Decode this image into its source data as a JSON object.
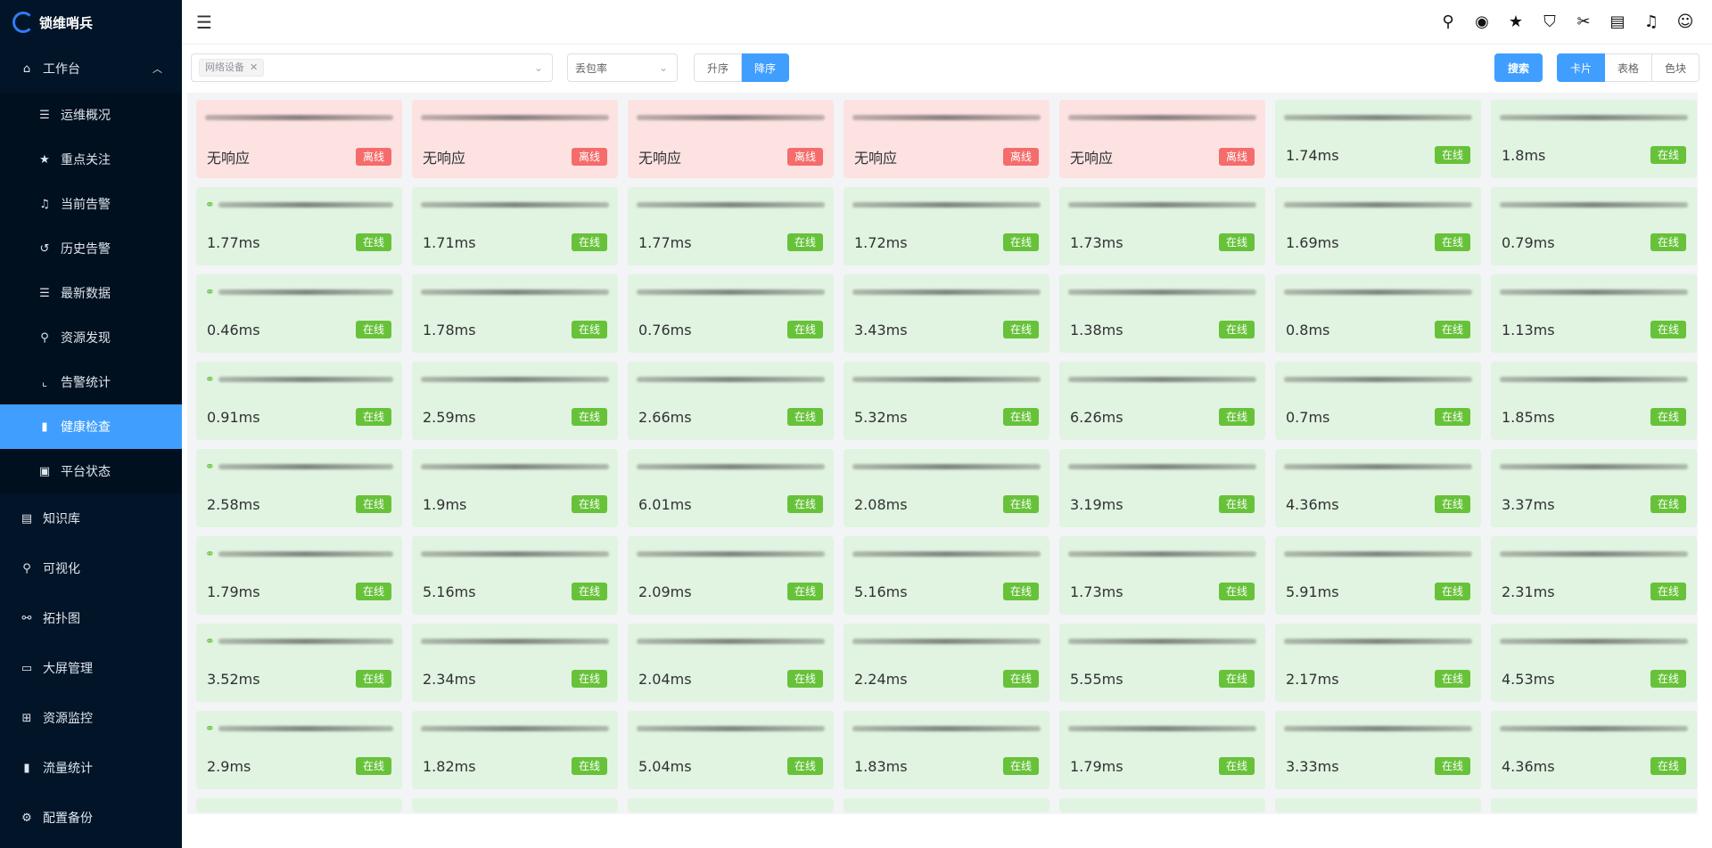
{
  "brand": {
    "name": "锁维哨兵"
  },
  "sidebar": {
    "workbench": {
      "label": "工作台",
      "icon": "home-icon"
    },
    "submenu": [
      {
        "label": "运维概况",
        "icon": "list-icon"
      },
      {
        "label": "重点关注",
        "icon": "star-icon"
      },
      {
        "label": "当前告警",
        "icon": "bell-icon"
      },
      {
        "label": "历史告警",
        "icon": "history-icon"
      },
      {
        "label": "最新数据",
        "icon": "database-icon"
      },
      {
        "label": "资源发现",
        "icon": "search-zoom-icon"
      },
      {
        "label": "告警统计",
        "icon": "line-chart-icon"
      },
      {
        "label": "健康检查",
        "icon": "bar-chart-icon",
        "active": true
      },
      {
        "label": "平台状态",
        "icon": "status-icon"
      }
    ],
    "items": [
      {
        "label": "知识库",
        "icon": "book-icon"
      },
      {
        "label": "可视化",
        "icon": "magnifier-icon"
      },
      {
        "label": "拓扑图",
        "icon": "topology-icon"
      },
      {
        "label": "大屏管理",
        "icon": "monitor-icon"
      },
      {
        "label": "资源监控",
        "icon": "grid-icon"
      },
      {
        "label": "流量统计",
        "icon": "bars-icon"
      },
      {
        "label": "配置备份",
        "icon": "backup-icon"
      }
    ]
  },
  "filters": {
    "device_tag": "网络设备",
    "metric": "丢包率",
    "sort_asc": "升序",
    "sort_desc": "降序",
    "search": "搜索",
    "view_card": "卡片",
    "view_table": "表格",
    "view_color": "色块"
  },
  "status": {
    "online": "在线",
    "offline": "离线"
  },
  "cards": [
    [
      "无响应",
      "无响应",
      "无响应",
      "无响应",
      "无响应",
      "1.74ms",
      "1.8ms"
    ],
    [
      "1.77ms",
      "1.71ms",
      "1.77ms",
      "1.72ms",
      "1.73ms",
      "1.69ms",
      "0.79ms"
    ],
    [
      "0.46ms",
      "1.78ms",
      "0.76ms",
      "3.43ms",
      "1.38ms",
      "0.8ms",
      "1.13ms"
    ],
    [
      "0.91ms",
      "2.59ms",
      "2.66ms",
      "5.32ms",
      "6.26ms",
      "0.7ms",
      "1.85ms"
    ],
    [
      "2.58ms",
      "1.9ms",
      "6.01ms",
      "2.08ms",
      "3.19ms",
      "4.36ms",
      "3.37ms"
    ],
    [
      "1.79ms",
      "5.16ms",
      "2.09ms",
      "5.16ms",
      "1.73ms",
      "5.91ms",
      "2.31ms"
    ],
    [
      "3.52ms",
      "2.34ms",
      "2.04ms",
      "2.24ms",
      "5.55ms",
      "2.17ms",
      "4.53ms"
    ],
    [
      "2.9ms",
      "1.82ms",
      "5.04ms",
      "1.83ms",
      "1.79ms",
      "3.33ms",
      "4.36ms"
    ]
  ],
  "colors": {
    "accent": "#409eff",
    "online_bg": "#e1f3e1",
    "offline_bg": "#fde2e2",
    "online": "#67c23a",
    "offline": "#f56c6c",
    "sidebar_bg": "#021427"
  }
}
